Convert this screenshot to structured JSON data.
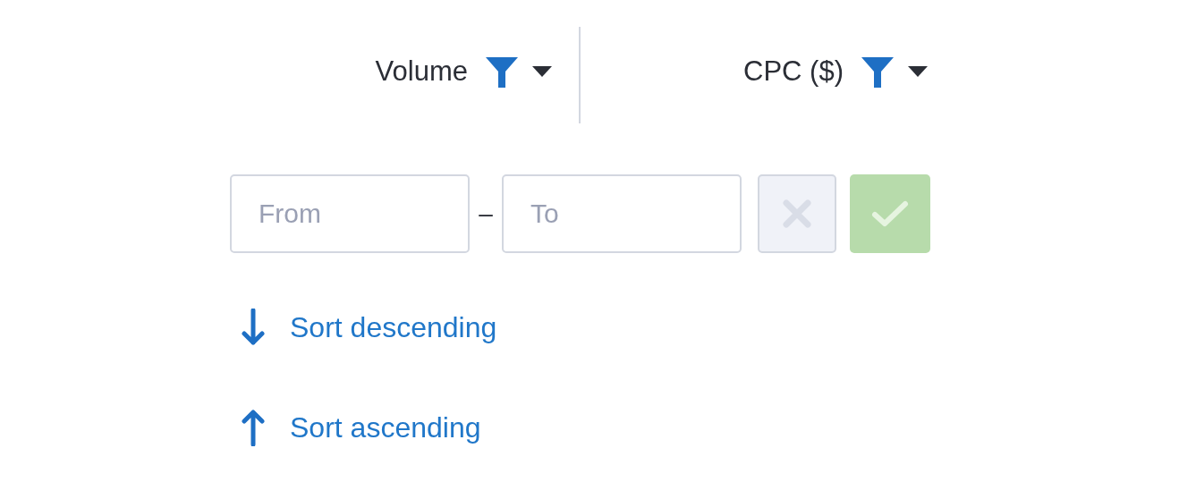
{
  "columns": [
    {
      "label": "Volume",
      "filter_active": true
    },
    {
      "label": "CPC ($)",
      "filter_active": true
    }
  ],
  "range_filter": {
    "from": {
      "placeholder": "From"
    },
    "separator": "–",
    "to": {
      "placeholder": "To"
    },
    "clear_button": {
      "disabled": true
    },
    "apply_button": {
      "disabled": true
    }
  },
  "sort_options": [
    {
      "kind": "descending",
      "label": "Sort descending"
    },
    {
      "kind": "ascending",
      "label": "Sort ascending"
    }
  ]
}
